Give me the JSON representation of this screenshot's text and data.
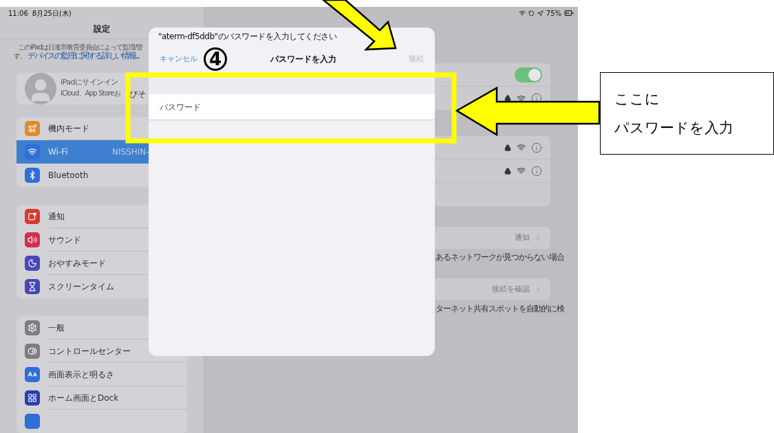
{
  "status_bar": {
    "time": "11:06",
    "date": "8月25日(木)",
    "battery": "75%"
  },
  "sidebar": {
    "title": "設定",
    "supervision": {
      "text": "このiPadは日進市教育委員会によって監理/管",
      "continuation": "す。",
      "link": "デバイスの監理に関する詳しい情報..."
    },
    "account": {
      "title": "iPadにサインイン",
      "subtitle": "iCloud、App Storeお",
      "subtitle_continued": "びそ"
    },
    "groups": [
      [
        {
          "label": "機内モード",
          "color": "#e08a2c",
          "selected": false
        },
        {
          "label": "Wi-Fi",
          "value": "NISSHIN-",
          "color": "#2f6fd6",
          "selected": true
        },
        {
          "label": "Bluetooth",
          "color": "#2f6fd6",
          "selected": false
        }
      ],
      [
        {
          "label": "通知",
          "color": "#d9392f",
          "selected": false
        },
        {
          "label": "サウンド",
          "color": "#d62f4b",
          "selected": false
        },
        {
          "label": "おやすみモード",
          "color": "#4a47b8",
          "selected": false
        },
        {
          "label": "スクリーンタイム",
          "color": "#4a47b8",
          "selected": false
        }
      ],
      [
        {
          "label": "一般",
          "color": "#7d7d82",
          "selected": false
        },
        {
          "label": "コントロールセンター",
          "color": "#7d7d82",
          "selected": false
        },
        {
          "label": "画面表示と明るさ",
          "color": "#2f6fd6",
          "selected": false
        },
        {
          "label": "ホーム画面とDock",
          "color": "#2a3fb0",
          "selected": false
        }
      ]
    ]
  },
  "detail": {
    "wifi_on": true,
    "current_network": {
      "secured": true
    },
    "other_networks": [
      {
        "secured": true
      },
      {
        "secured": true
      }
    ],
    "ask_to_join": {
      "value": "通知",
      "caption": "あるネットワークが見つからない場合"
    },
    "auto_join_hotspot": {
      "value": "接続を確認",
      "caption": "ターネット共有スポットを自動的に検"
    }
  },
  "modal": {
    "message": "\"aterm-df5ddb\"のパスワードを入力してください",
    "cancel": "キャンセル",
    "title": "パスワードを入力",
    "connect": {
      "label": "接続",
      "disabled": true
    },
    "password_field": {
      "placeholder": "パスワード"
    }
  },
  "annotation": {
    "step": "4",
    "callout_lines": [
      "ここに",
      "パスワードを入力"
    ]
  }
}
